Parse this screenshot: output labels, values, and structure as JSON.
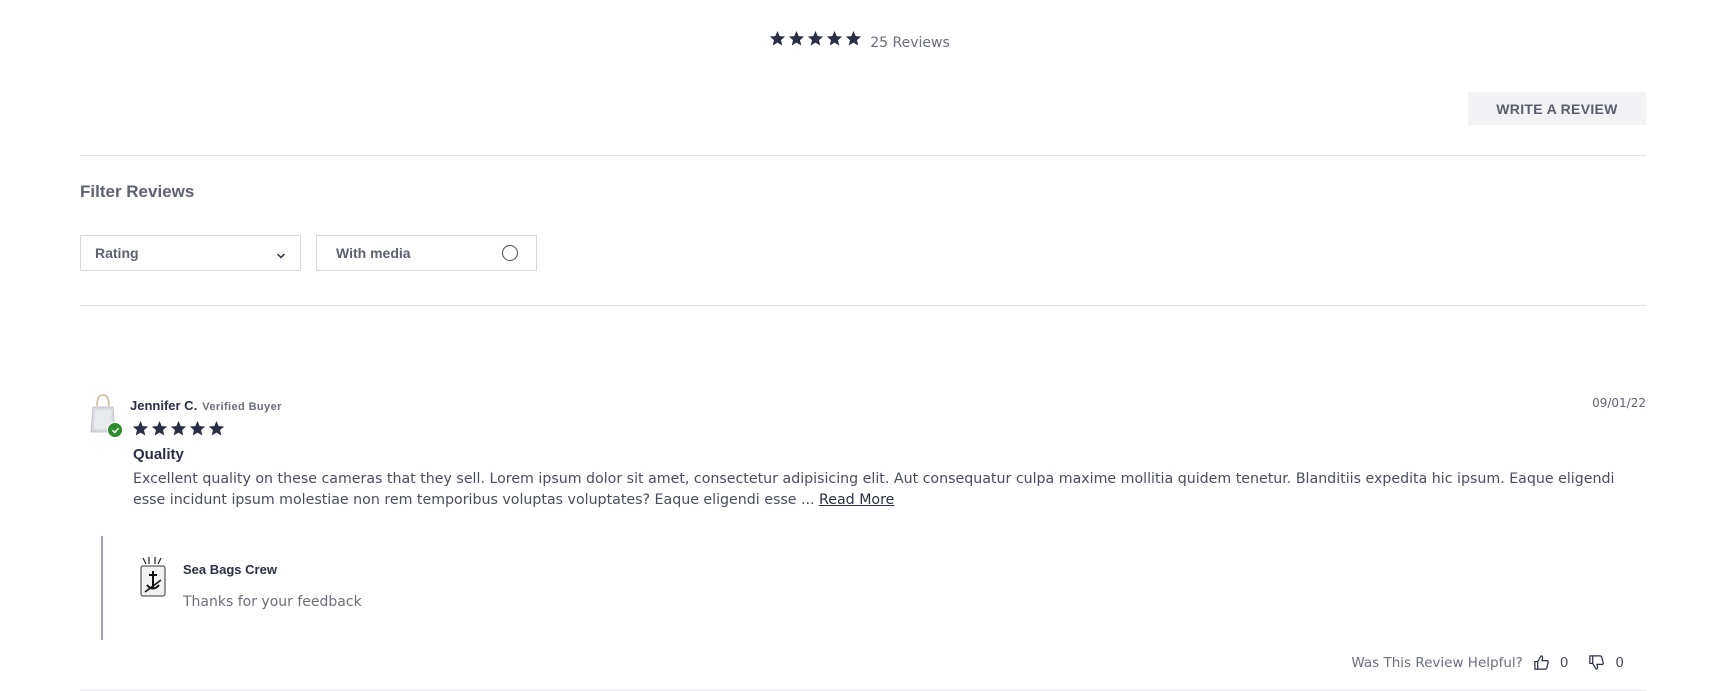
{
  "summary": {
    "rating": 5,
    "count_label": "25 Reviews"
  },
  "actions": {
    "write_review_label": "WRITE A REVIEW"
  },
  "filters": {
    "title": "Filter Reviews",
    "rating_label": "Rating",
    "media_label": "With media",
    "media_checked": false
  },
  "review": {
    "author": "Jennifer C.",
    "verified_label": "Verified Buyer",
    "date": "09/01/22",
    "rating": 5,
    "title": "Quality",
    "body": "Excellent quality on these cameras that they sell. Lorem ipsum dolor sit amet, consectetur adipisicing elit. Aut consequatur culpa maxime mollitia quidem tenetur. Blanditiis expedita hic ipsum. Eaque eligendi esse incidunt ipsum molestiae non rem temporibus voluptas voluptates? Eaque eligendi esse ...",
    "read_more_label": "Read More",
    "reply": {
      "author": "Sea Bags Crew",
      "text": "Thanks for your feedback"
    },
    "helpful": {
      "prompt": "Was This Review Helpful?",
      "up_count": "0",
      "down_count": "0"
    }
  },
  "colors": {
    "star": "#2b2f45",
    "verified": "#2e8b2e",
    "button_bg": "#f3f3f5",
    "divider": "#e4e4e8"
  },
  "icons": {
    "star": "star-icon",
    "chevron": "chevron-down-icon",
    "radio": "radio-icon",
    "thumbs_up": "thumbs-up-icon",
    "thumbs_down": "thumbs-down-icon",
    "check": "check-icon"
  }
}
